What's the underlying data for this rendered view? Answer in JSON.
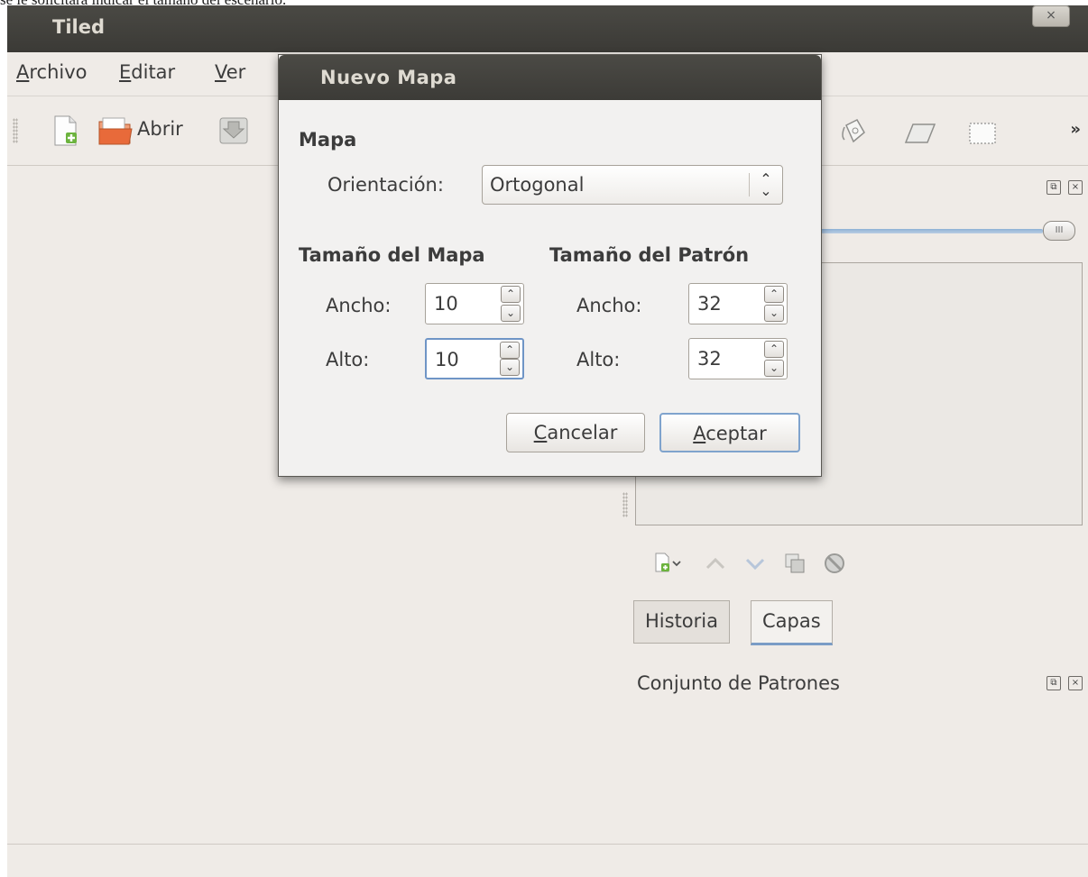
{
  "caption": "se le solicitará indicar el tamaño del escenario.",
  "window": {
    "title": "Tiled",
    "close_glyph": "×"
  },
  "menubar": {
    "items": [
      {
        "mnemonic": "A",
        "rest": "rchivo"
      },
      {
        "mnemonic": "E",
        "rest": "ditar"
      },
      {
        "mnemonic": "V",
        "rest": "er"
      }
    ]
  },
  "toolbar": {
    "open_label": "Abrir",
    "overflow": "»",
    "icons": [
      "new-file-icon",
      "open-folder-icon",
      "save-icon",
      "bucket-fill-icon",
      "eraser-icon",
      "rect-select-icon"
    ]
  },
  "dock": {
    "layer_tabs": [
      "Historia",
      "Capas"
    ],
    "active_tab": "Capas",
    "tileset_title": "Conjunto de Patrones",
    "float_glyph": "⧉",
    "close_glyph": "×",
    "opacity_handle": "III",
    "layer_tools": [
      "add-layer-icon",
      "move-up-icon",
      "move-down-icon",
      "duplicate-layer-icon",
      "remove-layer-icon"
    ]
  },
  "dialog": {
    "title": "Nuevo Mapa",
    "section_map": "Mapa",
    "orientation_label": "Orientación:",
    "orientation_value": "Ortogonal",
    "map_size_heading": "Tamaño del Mapa",
    "tile_size_heading": "Tamaño del Patrón",
    "map_width_label": "Ancho:",
    "map_width_value": "10",
    "map_height_label": "Alto:",
    "map_height_value": "10",
    "tile_width_label": "Ancho:",
    "tile_width_value": "32",
    "tile_height_label": "Alto:",
    "tile_height_value": "32",
    "cancel": {
      "mnemonic": "C",
      "rest": "ancelar"
    },
    "accept": {
      "mnemonic": "A",
      "rest": "ceptar"
    }
  }
}
